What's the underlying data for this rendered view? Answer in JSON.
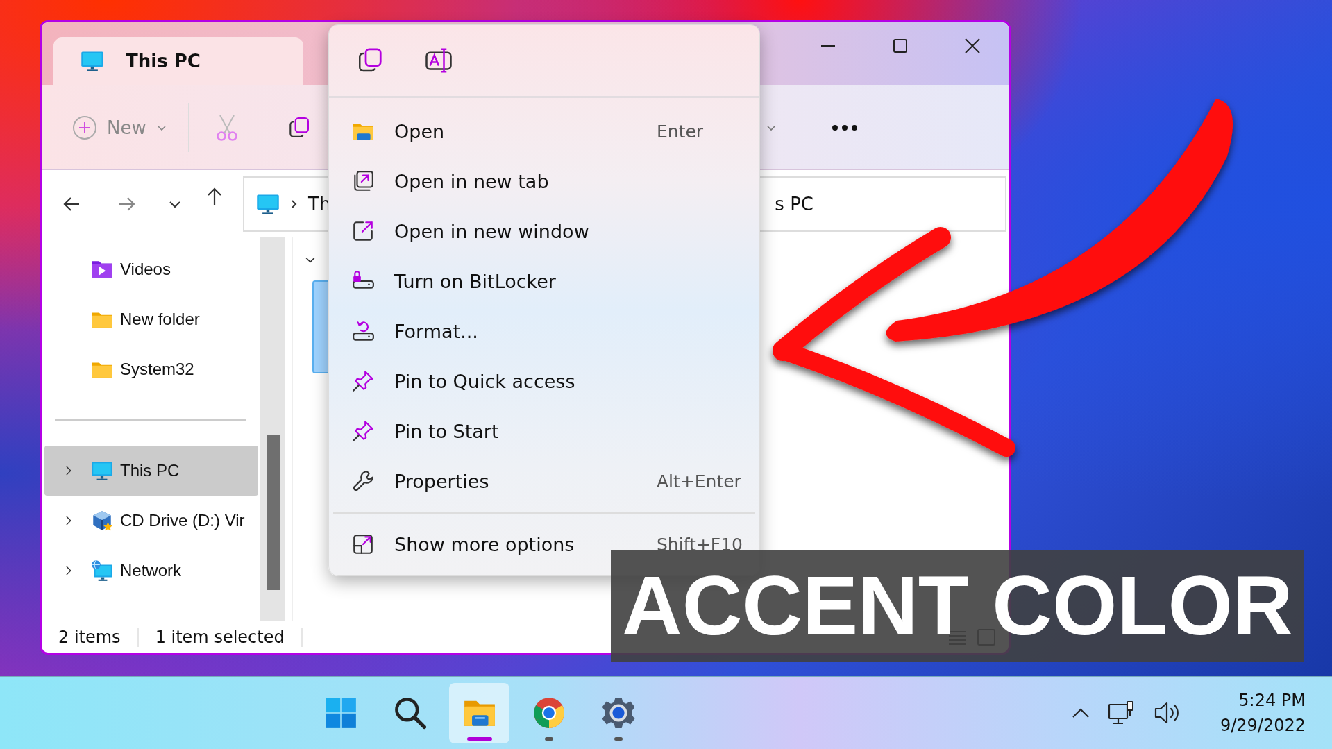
{
  "window": {
    "title": "This PC"
  },
  "toolbar": {
    "new_label": "New"
  },
  "address_bar": {
    "text_before_menu": "Th",
    "text_after_menu": "s PC"
  },
  "sidebar": {
    "sections": [
      {
        "items": [
          {
            "label": "Videos",
            "kind": "videos",
            "has_children": false,
            "selected": false
          },
          {
            "label": "New folder",
            "kind": "folder",
            "has_children": false,
            "selected": false
          },
          {
            "label": "System32",
            "kind": "folder",
            "has_children": false,
            "selected": false
          }
        ]
      },
      {
        "items": [
          {
            "label": "This PC",
            "kind": "pc",
            "has_children": true,
            "selected": true
          },
          {
            "label": "CD Drive (D:) Vir",
            "kind": "cd",
            "has_children": true,
            "selected": false
          },
          {
            "label": "Network",
            "kind": "network",
            "has_children": true,
            "selected": false
          }
        ]
      }
    ]
  },
  "status_bar": {
    "items": [
      "2 items",
      "1 item selected"
    ]
  },
  "context_menu": {
    "top_actions": [
      {
        "kind": "copy"
      },
      {
        "kind": "rename"
      }
    ],
    "items": [
      {
        "label": "Open",
        "shortcut": "Enter",
        "kind": "open"
      },
      {
        "label": "Open in new tab",
        "kind": "new-tab"
      },
      {
        "label": "Open in new window",
        "kind": "new-window"
      },
      {
        "label": "Turn on BitLocker",
        "kind": "bitlocker"
      },
      {
        "label": "Format...",
        "kind": "format"
      },
      {
        "label": "Pin to Quick access",
        "kind": "pin"
      },
      {
        "label": "Pin to Start",
        "kind": "pin"
      },
      {
        "label": "Properties",
        "shortcut": "Alt+Enter",
        "kind": "properties"
      }
    ],
    "footer": {
      "label": "Show more options",
      "shortcut": "Shift+F10",
      "kind": "more"
    }
  },
  "overlay_caption": "ACCENT COLOR",
  "taskbar": {
    "apps": [
      {
        "kind": "start",
        "running": false,
        "active": false
      },
      {
        "kind": "search",
        "running": false,
        "active": false
      },
      {
        "kind": "explorer",
        "running": true,
        "active": true
      },
      {
        "kind": "chrome",
        "running": true,
        "active": false
      },
      {
        "kind": "settings",
        "running": true,
        "active": false
      }
    ],
    "clock": {
      "time": "5:24 PM",
      "date": "9/29/2022"
    }
  }
}
